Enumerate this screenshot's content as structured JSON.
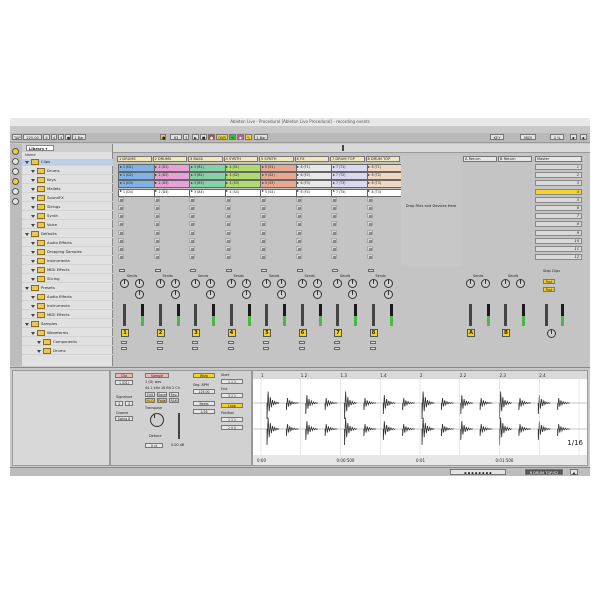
{
  "window": {
    "title": "Ableton Live - Procedural [Ableton Live Procedural] - recording events"
  },
  "transport": {
    "tap": "TAP",
    "tempo": "125.00",
    "sig_num": "4",
    "sig_den": "4",
    "quant": "1 Bar",
    "ovr": "OVR",
    "bar_pos": "63",
    "beat": "3",
    "key": "KEY",
    "midi": "MIDI",
    "cpu": "4 %"
  },
  "browser": {
    "library_label": "Library",
    "column_header": "Name",
    "items": [
      {
        "label": "Clips",
        "level": 0,
        "highlight": true
      },
      {
        "label": "Drums",
        "level": 1
      },
      {
        "label": "Keys",
        "level": 1
      },
      {
        "label": "Mallets",
        "level": 1
      },
      {
        "label": "SoundFX",
        "level": 1
      },
      {
        "label": "Strings",
        "level": 1
      },
      {
        "label": "Synth",
        "level": 1
      },
      {
        "label": "Voice",
        "level": 1
      },
      {
        "label": "Defaults",
        "level": 0
      },
      {
        "label": "Audio Effects",
        "level": 1
      },
      {
        "label": "Dropping Samples",
        "level": 1
      },
      {
        "label": "Instruments",
        "level": 1
      },
      {
        "label": "MIDI Effects",
        "level": 1
      },
      {
        "label": "Slicing",
        "level": 1
      },
      {
        "label": "Presets",
        "level": 0
      },
      {
        "label": "Audio Effects",
        "level": 1
      },
      {
        "label": "Instruments",
        "level": 1
      },
      {
        "label": "MIDI Effects",
        "level": 1
      },
      {
        "label": "Samples",
        "level": 0
      },
      {
        "label": "Waveforms",
        "level": 1
      },
      {
        "label": "Components",
        "level": 2
      },
      {
        "label": "Drums",
        "level": 2
      }
    ]
  },
  "session": {
    "tracks": [
      {
        "name": "1 DRUMS",
        "color": "#7fb3e8",
        "num": "1",
        "clips": [
          "1 (D1)",
          "1 (D2)",
          "1 (D3)",
          "1 (D4)"
        ],
        "played": 3
      },
      {
        "name": "2 DRUMS",
        "color": "#e8a0d6",
        "num": "2",
        "clips": [
          "2 (D1)",
          "2 (D2)",
          "2 (D3)",
          "2 (D4)"
        ],
        "played": 3
      },
      {
        "name": "3 BASS",
        "color": "#86d2a8",
        "num": "3",
        "clips": [
          "3 (B1)",
          "3 (B2)",
          "3 (B3)",
          "3 (B4)"
        ],
        "played": 3
      },
      {
        "name": "4 SYNTH",
        "color": "#b0dc6e",
        "num": "4",
        "clips": [
          "4 (S1)",
          "4 (S2)",
          "4 (S3)",
          "4 (S4)"
        ],
        "played": 3
      },
      {
        "name": "5 SYNTH",
        "color": "#e8a890",
        "num": "5",
        "clips": [
          "5 (S1)",
          "5 (S2)",
          "5 (S3)",
          "5 (S4)"
        ],
        "played": 3
      },
      {
        "name": "6 FX",
        "color": "#e8e8e8",
        "num": "6",
        "clips": [
          "6 (F1)",
          "6 (F2)",
          "6 (F3)",
          "6 (F4)"
        ],
        "played": 3
      },
      {
        "name": "7 DRUM TOP",
        "color": "#d8d8f0",
        "num": "7",
        "clips": [
          "7 (T1)",
          "7 (T2)",
          "7 (T3)",
          "7 (T4)"
        ],
        "played": 3
      },
      {
        "name": "8 DRUM TOP",
        "color": "#f2d6c0",
        "num": "8",
        "clips": [
          "8 (T1)",
          "8 (T2)",
          "8 (T3)",
          "8 (T4)"
        ],
        "played": 3
      }
    ],
    "drop_text": "Drop Files and Devices Here",
    "sends_label": "Sends",
    "returns": [
      {
        "name": "A Return",
        "num": "A"
      },
      {
        "name": "B Return",
        "num": "B"
      }
    ],
    "master": {
      "name": "Master",
      "stop_clips": "Stop Clips",
      "post": "Post"
    },
    "scenes": [
      "1",
      "2",
      "3",
      "4",
      "5",
      "6",
      "7",
      "8",
      "9",
      "10",
      "11",
      "12"
    ],
    "selected_scene": 3
  },
  "clip_view": {
    "clip_label": "Clip",
    "sample_label": "Sample",
    "clip_name": "1 (D1)",
    "signature_label": "Signature",
    "sig_num": "4",
    "sig_den": "4",
    "groove_label": "Groove",
    "groove_value": "Swing 8",
    "sample_name": "1 (D) wav",
    "sample_info": "44.1 kHz 16 Bit 2 Ch",
    "buttons": [
      "Edit",
      "Save",
      "Rev.",
      "Hi-Q",
      "Fade",
      "RAM"
    ],
    "warp": "Warp",
    "seg_bpm_label": "Seg. BPM",
    "seg_bpm": "125.00",
    "start_label": "Start",
    "end_label": "End",
    "loop_label": "Loop",
    "position_label": "Position",
    "transpose_label": "Transpose",
    "detune_label": "Detune",
    "detune_value": "0 ct",
    "volume_value": "0.00 dB",
    "mode": "Beats",
    "rate": "1/16",
    "ruler": [
      "1",
      "1.2",
      "1.3",
      "1.4",
      "2",
      "2.2",
      "2.3",
      "2.4"
    ],
    "time_ruler": [
      "0:00",
      "0:00:500",
      "0:01",
      "0:01:500"
    ],
    "zoom": "1/16"
  },
  "status": {
    "track_label": "8 DRUM TOP/S2"
  }
}
